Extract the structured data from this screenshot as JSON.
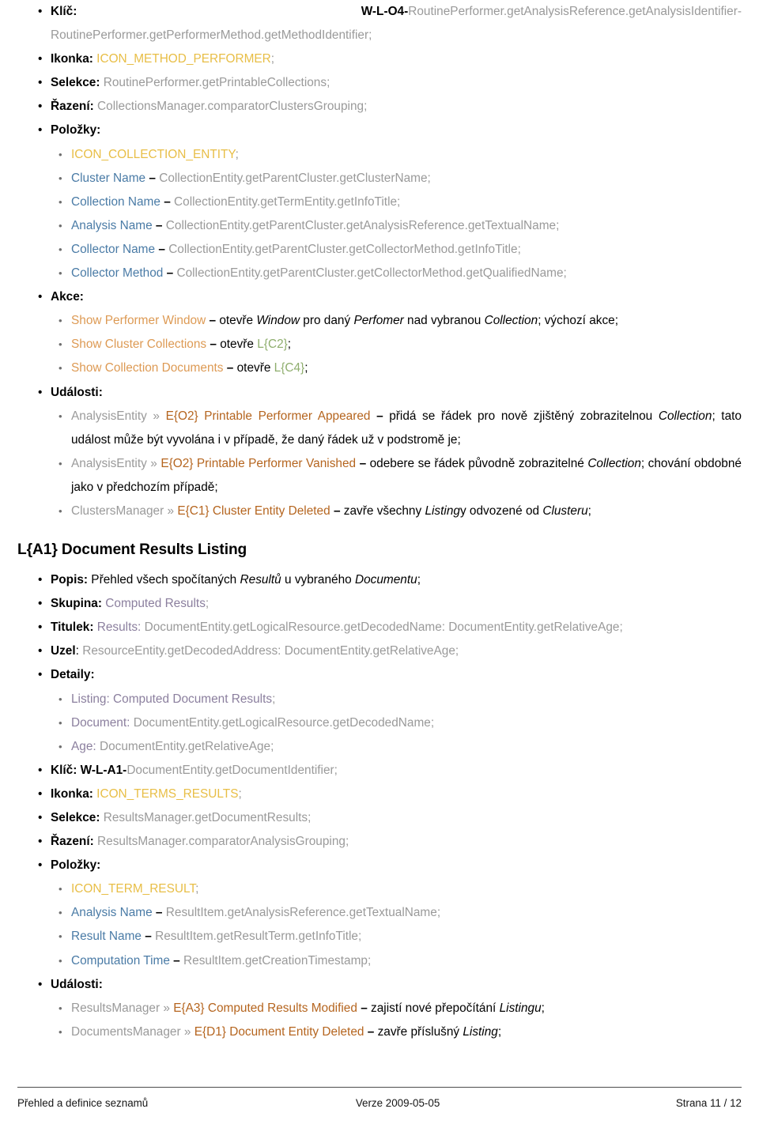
{
  "colors": {
    "icon_token": "#e8be46",
    "column_name": "#4a7ba6",
    "action_name": "#dd9a54",
    "event_name": "#b5651f",
    "listing_ref": "#8fae6e",
    "group_label": "#8b7f9e",
    "code_path": "#9a9a9a",
    "body_text": "#000000"
  },
  "section_o4": {
    "key": {
      "label": "Klíč:",
      "id": "W-L-O4-",
      "path_line1": "RoutinePerformer.getAnalysisReference.getAnalysisIdentifier-RoutinePerformer.getPerformer",
      "path_line2": "Method.getMethodIdentifier",
      "semi": ";"
    },
    "icon": {
      "label": "Ikonka:",
      "value": "ICON_METHOD_PERFORMER",
      "semi": ";"
    },
    "selection": {
      "label": "Selekce:",
      "value": "RoutinePerformer.getPrintableCollections",
      "semi": ";"
    },
    "ordering": {
      "label": "Řazení:",
      "value": "CollectionsManager.comparatorClustersGrouping",
      "semi": ";"
    },
    "items_label": "Položky:",
    "items": [
      {
        "kind": "icon",
        "name": "ICON_COLLECTION_ENTITY",
        "dash": "",
        "path": "",
        "semi": ";"
      },
      {
        "kind": "column",
        "name": "Cluster Name",
        "dash": "–",
        "path": "CollectionEntity.getParentCluster.getClusterName",
        "semi": ";"
      },
      {
        "kind": "column",
        "name": "Collection Name",
        "dash": "–",
        "path": "CollectionEntity.getTermEntity.getInfoTitle",
        "semi": ";"
      },
      {
        "kind": "column",
        "name": "Analysis Name",
        "dash": "–",
        "path": "CollectionEntity.getParentCluster.getAnalysisReference.getTextualName",
        "semi": ";"
      },
      {
        "kind": "column",
        "name": "Collector Name",
        "dash": "–",
        "path": "CollectionEntity.getParentCluster.getCollectorMethod.getInfoTitle",
        "semi": ";"
      },
      {
        "kind": "column",
        "name": "Collector Method",
        "dash": "–",
        "path": "CollectionEntity.getParentCluster.getCollectorMethod.getQualifiedName",
        "semi": ";"
      }
    ],
    "actions_label": "Akce:",
    "actions": [
      {
        "name": "Show Performer Window",
        "dash": "–",
        "desc_parts": [
          {
            "t": "otevře ",
            "s": "plain"
          },
          {
            "t": "Window",
            "s": "italic"
          },
          {
            "t": " pro daný ",
            "s": "plain"
          },
          {
            "t": "Perfomer",
            "s": "italic"
          },
          {
            "t": " nad vybranou ",
            "s": "plain"
          },
          {
            "t": "Collection",
            "s": "italic"
          },
          {
            "t": "; výchozí akce;",
            "s": "plain"
          }
        ]
      },
      {
        "name": "Show Cluster Collections",
        "dash": "–",
        "desc_parts": [
          {
            "t": "otevře ",
            "s": "plain"
          },
          {
            "t": "L{C2}",
            "s": "ref"
          },
          {
            "t": ";",
            "s": "plain"
          }
        ]
      },
      {
        "name": "Show Collection Documents",
        "dash": "–",
        "desc_parts": [
          {
            "t": "otevře ",
            "s": "plain"
          },
          {
            "t": "L{C4}",
            "s": "ref"
          },
          {
            "t": ";",
            "s": "plain"
          }
        ]
      }
    ],
    "events_label": "Události:",
    "events": [
      {
        "source": "AnalysisEntity",
        "arrow": "»",
        "name": "E{O2} Printable Performer Appeared",
        "dash": "–",
        "desc_parts": [
          {
            "t": "přidá se řádek pro nově zjištěný zobrazitelnou ",
            "s": "plain"
          },
          {
            "t": "Collection",
            "s": "italic"
          },
          {
            "t": "; tato událost může být vyvolána i v případě, že daný řádek už v podstromě je;",
            "s": "plain"
          }
        ]
      },
      {
        "source": "AnalysisEntity",
        "arrow": "»",
        "name": "E{O2} Printable Performer Vanished",
        "dash": "–",
        "desc_parts": [
          {
            "t": "odebere se řádek původně zobrazitelné ",
            "s": "plain"
          },
          {
            "t": "Collection",
            "s": "italic"
          },
          {
            "t": "; chování obdobné jako v předchozím případě;",
            "s": "plain"
          }
        ]
      },
      {
        "source": "ClustersManager",
        "arrow": "»",
        "name": "E{C1} Cluster Entity Deleted",
        "dash": "–",
        "desc_parts": [
          {
            "t": "zavře všechny ",
            "s": "plain"
          },
          {
            "t": "Listing",
            "s": "italic"
          },
          {
            "t": "y odvozené od ",
            "s": "plain"
          },
          {
            "t": "Clusteru",
            "s": "italic"
          },
          {
            "t": ";",
            "s": "plain"
          }
        ]
      }
    ]
  },
  "section_a1": {
    "heading": "L{A1} Document Results Listing",
    "description": {
      "label": "Popis:",
      "parts": [
        {
          "t": " Přehled všech spočítaných ",
          "s": "plain"
        },
        {
          "t": "Resultů",
          "s": "italic"
        },
        {
          "t": " u vybraného ",
          "s": "plain"
        },
        {
          "t": "Documentu",
          "s": "italic"
        },
        {
          "t": ";",
          "s": "plain"
        }
      ]
    },
    "group": {
      "label": "Skupina:",
      "value": "Computed Results",
      "semi": ";"
    },
    "title": {
      "label": "Titulek:",
      "value_prefix": "Results:",
      "value_rest": " DocumentEntity.getLogicalResource.getDecodedName: DocumentEntity.getRelativeAge",
      "semi": ";"
    },
    "node": {
      "label": "Uzel",
      "colon": ":",
      "value": "ResourceEntity.getDecodedAddress: DocumentEntity.getRelativeAge",
      "semi": ";"
    },
    "details_label": "Detaily:",
    "details": [
      {
        "label": "Listing:",
        "value": " Computed Document Results",
        "value_style": "purple",
        "semi": ";"
      },
      {
        "label": "Document:",
        "value": " DocumentEntity.getLogicalResource.getDecodedName",
        "value_style": "gray",
        "semi": ";"
      },
      {
        "label": "Age:",
        "value": " DocumentEntity.getRelativeAge",
        "value_style": "gray",
        "semi": ";"
      }
    ],
    "key": {
      "label": "Klíč:",
      "id": "W-L-A1-",
      "path": "DocumentEntity.getDocumentIdentifier",
      "semi": ";"
    },
    "icon": {
      "label": "Ikonka:",
      "value": "ICON_TERMS_RESULTS",
      "semi": ";"
    },
    "selection": {
      "label": "Selekce:",
      "value": "ResultsManager.getDocumentResults",
      "semi": ";"
    },
    "ordering": {
      "label": "Řazení:",
      "value": "ResultsManager.comparatorAnalysisGrouping",
      "semi": ";"
    },
    "items_label": "Položky:",
    "items": [
      {
        "kind": "icon",
        "name": "ICON_TERM_RESULT",
        "dash": "",
        "path": "",
        "semi": ";"
      },
      {
        "kind": "column",
        "name": "Analysis Name",
        "dash": "–",
        "path": "ResultItem.getAnalysisReference.getTextualName",
        "semi": ";"
      },
      {
        "kind": "column",
        "name": "Result Name",
        "dash": "–",
        "path": "ResultItem.getResultTerm.getInfoTitle",
        "semi": ";"
      },
      {
        "kind": "column",
        "name": "Computation Time",
        "dash": "–",
        "path": "ResultItem.getCreationTimestamp",
        "semi": ";"
      }
    ],
    "events_label": "Události:",
    "events": [
      {
        "source": "ResultsManager",
        "arrow": "»",
        "name": "E{A3} Computed Results Modified",
        "dash": "–",
        "desc_parts": [
          {
            "t": "zajistí nové přepočítání ",
            "s": "plain"
          },
          {
            "t": "Listingu",
            "s": "italic"
          },
          {
            "t": ";",
            "s": "plain"
          }
        ]
      },
      {
        "source": "DocumentsManager",
        "arrow": "»",
        "name": "E{D1} Document Entity Deleted",
        "dash": "–",
        "desc_parts": [
          {
            "t": "zavře příslušný ",
            "s": "plain"
          },
          {
            "t": "Listing",
            "s": "italic"
          },
          {
            "t": ";",
            "s": "plain"
          }
        ]
      }
    ]
  },
  "footer": {
    "left": "Přehled a definice seznamů",
    "center": "Verze 2009-05-05",
    "right": "Strana 11 / 12"
  }
}
